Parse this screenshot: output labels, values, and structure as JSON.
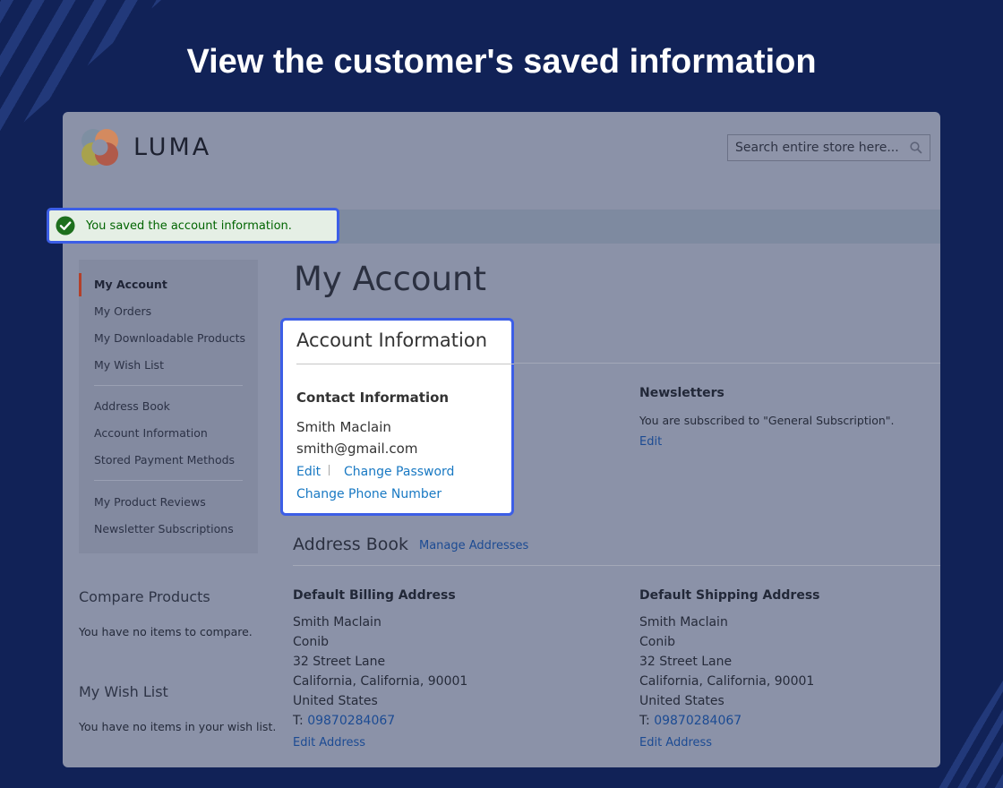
{
  "headline": "View the customer's saved information",
  "store": {
    "brand": "LUMA",
    "search_placeholder": "Search entire store here..."
  },
  "message": {
    "success": "You saved the account information."
  },
  "sidebar": {
    "nav": [
      "My Account",
      "My Orders",
      "My Downloadable Products",
      "My Wish List",
      "Address Book",
      "Account Information",
      "Stored Payment Methods",
      "My Product Reviews",
      "Newsletter Subscriptions"
    ],
    "compare": {
      "title": "Compare Products",
      "empty": "You have no items to compare."
    },
    "wishlist": {
      "title": "My Wish List",
      "empty": "You have no items in your wish list."
    }
  },
  "main": {
    "page_title": "My Account",
    "account_info": {
      "title": "Account Information",
      "contact": {
        "title": "Contact Information",
        "name": "Smith Maclain",
        "email": "smith@gmail.com",
        "edit": "Edit",
        "change_password": "Change Password",
        "change_phone": "Change Phone Number"
      },
      "newsletters": {
        "title": "Newsletters",
        "text": "You are subscribed to \"General Subscription\".",
        "edit": "Edit"
      }
    },
    "address_book": {
      "title": "Address Book",
      "manage": "Manage Addresses",
      "billing": {
        "title": "Default Billing Address",
        "name": "Smith Maclain",
        "company": "Conib",
        "street": "32 Street Lane",
        "city_line": "California, California, 90001",
        "country": "United States",
        "phone_prefix": "T:",
        "phone": "09870284067",
        "edit": "Edit Address"
      },
      "shipping": {
        "title": "Default Shipping Address",
        "name": "Smith Maclain",
        "company": "Conib",
        "street": "32 Street Lane",
        "city_line": "California, California, 90001",
        "country": "United States",
        "phone_prefix": "T:",
        "phone": "09870284067",
        "edit": "Edit Address"
      }
    }
  },
  "colors": {
    "background": "#112257",
    "highlight_border": "#3c5ee6",
    "success_text": "#006400",
    "link": "#1979c3",
    "active_nav": "#b3402a"
  }
}
